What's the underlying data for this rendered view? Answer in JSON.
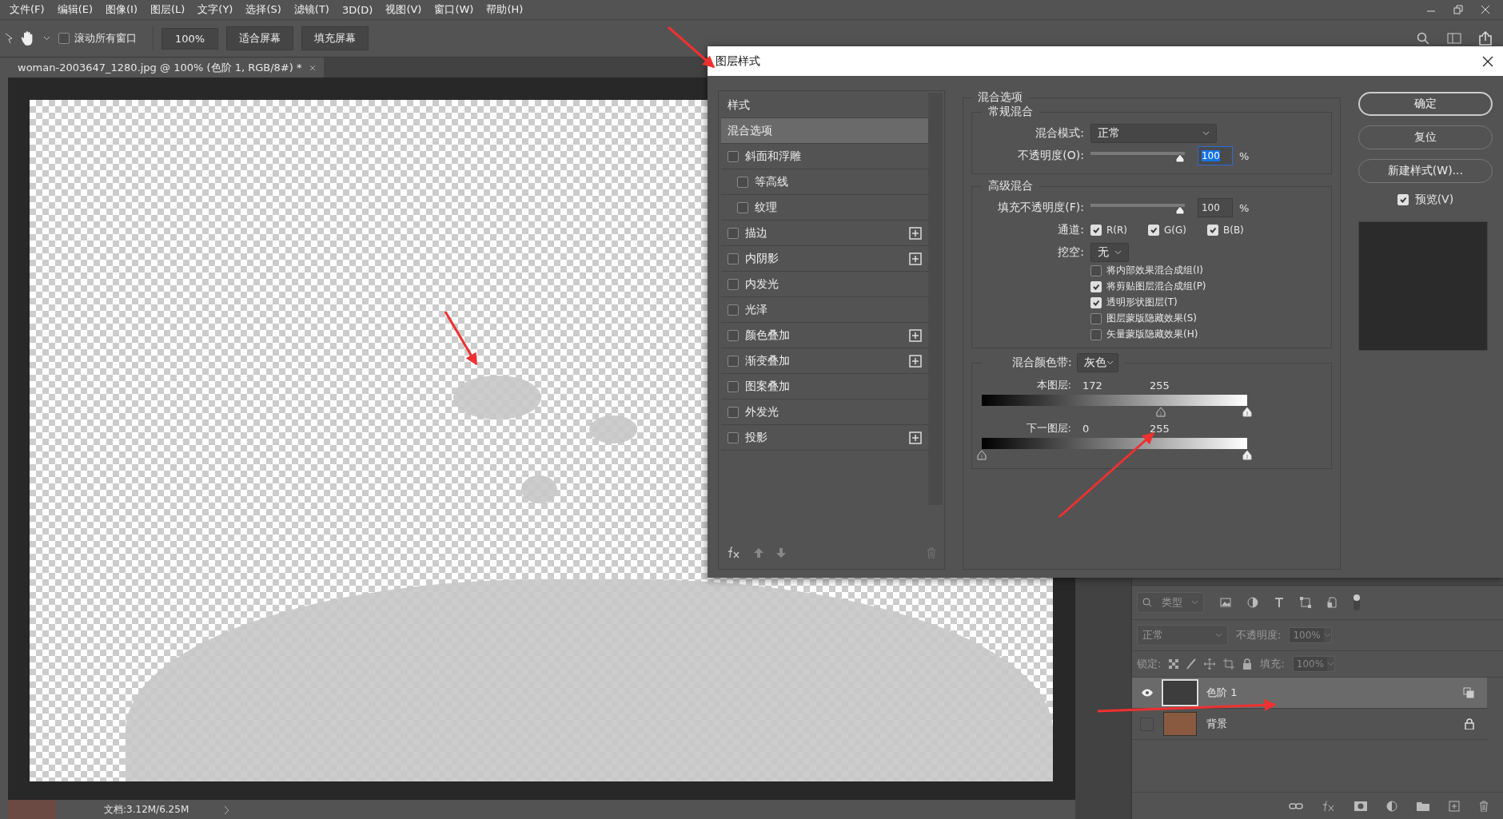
{
  "menu": [
    "文件(F)",
    "编辑(E)",
    "图像(I)",
    "图层(L)",
    "文字(Y)",
    "选择(S)",
    "滤镜(T)",
    "3D(D)",
    "视图(V)",
    "窗口(W)",
    "帮助(H)"
  ],
  "options_bar": {
    "scroll_all": {
      "label": "滚动所有窗口",
      "checked": false
    },
    "zoom": "100%",
    "buttons": [
      "适合屏幕",
      "填充屏幕"
    ]
  },
  "document_tab": {
    "title": "woman-2003647_1280.jpg @ 100% (色阶 1, RGB/8#) *"
  },
  "status_bar": {
    "doc_info": "文档:3.12M/6.25M"
  },
  "dialog": {
    "title": "图层样式",
    "style_items": [
      {
        "label": "样式",
        "kind": "header",
        "selected": false
      },
      {
        "label": "混合选项",
        "kind": "header",
        "selected": true
      },
      {
        "label": "斜面和浮雕",
        "kind": "effect",
        "checked": false,
        "selected": false,
        "addable": false
      },
      {
        "label": "等高线",
        "kind": "sub",
        "checked": false,
        "selected": false,
        "addable": false
      },
      {
        "label": "纹理",
        "kind": "sub",
        "checked": false,
        "selected": false,
        "addable": false
      },
      {
        "label": "描边",
        "kind": "effect",
        "checked": false,
        "selected": false,
        "addable": true
      },
      {
        "label": "内阴影",
        "kind": "effect",
        "checked": false,
        "selected": false,
        "addable": true
      },
      {
        "label": "内发光",
        "kind": "effect",
        "checked": false,
        "selected": false,
        "addable": false
      },
      {
        "label": "光泽",
        "kind": "effect",
        "checked": false,
        "selected": false,
        "addable": false
      },
      {
        "label": "颜色叠加",
        "kind": "effect",
        "checked": false,
        "selected": false,
        "addable": true
      },
      {
        "label": "渐变叠加",
        "kind": "effect",
        "checked": false,
        "selected": false,
        "addable": true
      },
      {
        "label": "图案叠加",
        "kind": "effect",
        "checked": false,
        "selected": false,
        "addable": false
      },
      {
        "label": "外发光",
        "kind": "effect",
        "checked": false,
        "selected": false,
        "addable": false
      },
      {
        "label": "投影",
        "kind": "effect",
        "checked": false,
        "selected": false,
        "addable": true
      }
    ],
    "blending": {
      "title": "混合选项",
      "general": {
        "title": "常规混合",
        "mode_label": "混合模式:",
        "mode": "正常",
        "opacity": {
          "label": "不透明度(O):",
          "level": 1,
          "value": "100",
          "unit": "%",
          "focused": true
        }
      },
      "advanced": {
        "title": "高级混合",
        "fill_opacity": {
          "label": "填充不透明度(F):",
          "level": 1,
          "value": "100",
          "unit": "%",
          "focused": false
        },
        "channels_label": "通道:",
        "channels": [
          {
            "label": "R(R)",
            "checked": true
          },
          {
            "label": "G(G)",
            "checked": true
          },
          {
            "label": "B(B)",
            "checked": true
          }
        ],
        "knockout_label": "挖空:",
        "knockout": "无",
        "options": [
          {
            "label": "将内部效果混合成组(I)",
            "checked": false
          },
          {
            "label": "将剪贴图层混合成组(P)",
            "checked": true
          },
          {
            "label": "透明形状图层(T)",
            "checked": true
          },
          {
            "label": "图层蒙版隐藏效果(S)",
            "checked": false
          },
          {
            "label": "矢量蒙版隐藏效果(H)",
            "checked": false
          }
        ]
      },
      "blend_if": {
        "label": "混合颜色带:",
        "value": "灰色",
        "bands": [
          {
            "label": "本图层:",
            "low": "172",
            "high": "255",
            "thumbs": [
              {
                "level": 0.6745
              },
              {
                "level": 1
              }
            ]
          },
          {
            "label": "下一图层:",
            "low": "0",
            "high": "255",
            "thumbs": [
              {
                "level": 0
              },
              {
                "level": 1
              }
            ]
          }
        ]
      }
    },
    "buttons": [
      {
        "label": "确定",
        "default": true
      },
      {
        "label": "复位",
        "default": false
      },
      {
        "label": "新建样式(W)...",
        "default": false
      }
    ],
    "preview": {
      "label": "预览(V)",
      "checked": true
    }
  },
  "layers_panel": {
    "filter": "类型",
    "blend_mode": "正常",
    "opacity_label": "不透明度:",
    "opacity": "100%",
    "lock_label": "锁定:",
    "fill_label": "填充:",
    "fill": "100%",
    "layers": [
      {
        "name": "色阶 1",
        "kind": "adjustment",
        "visible": true,
        "selected": true
      },
      {
        "name": "背景",
        "kind": "background",
        "visible": false,
        "selected": false
      }
    ]
  }
}
